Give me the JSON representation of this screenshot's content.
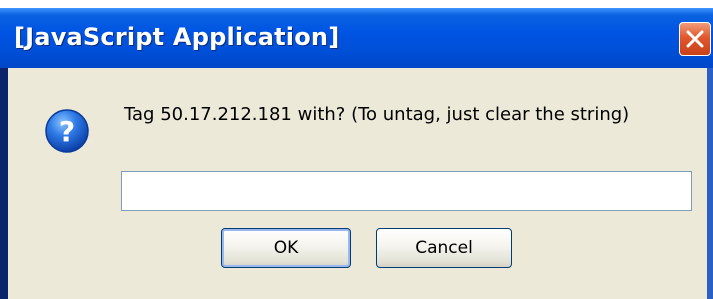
{
  "window": {
    "title": "[JavaScript Application]"
  },
  "dialog": {
    "icon": "question-icon",
    "prompt": "Tag 50.17.212.181 with? (To untag, just clear the string)",
    "input_value": "",
    "ok_label": "OK",
    "cancel_label": "Cancel"
  },
  "colors": {
    "titlebar": "#0054e3",
    "close_button": "#e2582c",
    "client_background": "#ece9d8",
    "input_border": "#7f9db9",
    "button_border": "#003c74"
  }
}
